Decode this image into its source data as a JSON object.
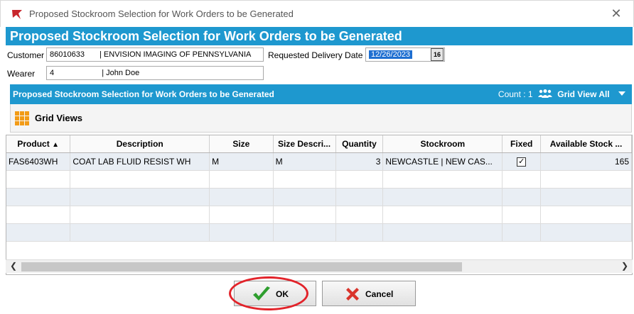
{
  "window": {
    "title": "Proposed Stockroom Selection for Work Orders to be Generated",
    "close_glyph": "✕"
  },
  "header": {
    "title": "Proposed Stockroom Selection for Work Orders to be Generated"
  },
  "form": {
    "customer_label": "Customer",
    "customer_number": "86010633",
    "customer_name": "| ENVISION IMAGING OF PENNSYLVANIA",
    "delivery_label": "Requested Delivery Date",
    "delivery_date": "12/26/2023",
    "calendar_button": "16",
    "wearer_label": "Wearer",
    "wearer_number": "4",
    "wearer_name": "| John Doe"
  },
  "grid": {
    "title": "Proposed Stockroom Selection for Work Orders to be Generated",
    "count_text": "Count : 1",
    "grid_view_all": "Grid View All",
    "grid_views_label": "Grid Views",
    "columns": [
      "Product",
      "Description",
      "Size",
      "Size Descri...",
      "Quantity",
      "Stockroom",
      "Fixed",
      "Available Stock ..."
    ],
    "rows": [
      {
        "product": "FAS6403WH",
        "description": "COAT LAB FLUID RESIST WH",
        "size": "M",
        "size_description": "M",
        "quantity": "3",
        "stockroom": "NEWCASTLE | NEW CAS...",
        "fixed": true,
        "available_stock": "165"
      }
    ],
    "fixed_check_glyph": "✓"
  },
  "buttons": {
    "ok_label": "OK",
    "cancel_label": "Cancel"
  },
  "colors": {
    "header_band": "#1e98cf",
    "selection": "#1f6fd1",
    "highlight_circle": "#e2232a",
    "ok_check": "#2e9e2e",
    "cancel_x": "#d9342b"
  }
}
